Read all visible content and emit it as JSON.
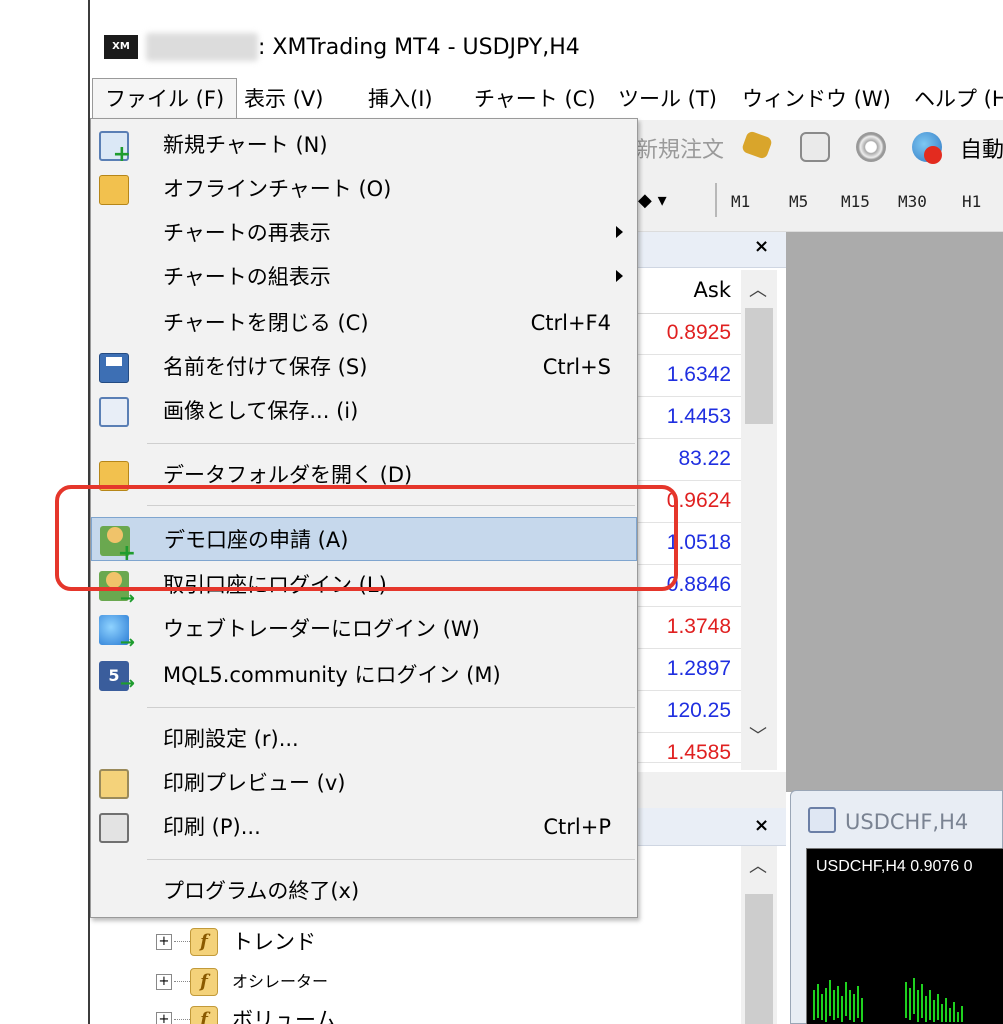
{
  "window": {
    "logo_text": "XM",
    "title": ": XMTrading MT4 - USDJPY,H4"
  },
  "menubar": {
    "items": [
      {
        "label": "ファイル (F)"
      },
      {
        "label": "表示 (V)"
      },
      {
        "label": "挿入(I)"
      },
      {
        "label": "チャート (C)"
      },
      {
        "label": "ツール (T)"
      },
      {
        "label": "ウィンドウ (W)"
      },
      {
        "label": "ヘルプ (H"
      }
    ]
  },
  "toolbar": {
    "new_order_label": "新規注文",
    "auto_trade_label": "自動",
    "timeframes": [
      "M1",
      "M5",
      "M15",
      "M30",
      "H1"
    ]
  },
  "market_watch": {
    "column_ask": "Ask",
    "close_symbol": "×",
    "prices": [
      {
        "value": "0.8925",
        "color": "#e02020"
      },
      {
        "value": "1.6342",
        "color": "#1f2fe0"
      },
      {
        "value": "1.4453",
        "color": "#1f2fe0"
      },
      {
        "value": "83.22",
        "color": "#1f2fe0"
      },
      {
        "value": "0.9624",
        "color": "#e02020"
      },
      {
        "value": "1.0518",
        "color": "#1f2fe0"
      },
      {
        "value": "0.8846",
        "color": "#1f2fe0"
      },
      {
        "value": "1.3748",
        "color": "#e02020"
      },
      {
        "value": "1.2897",
        "color": "#1f2fe0"
      },
      {
        "value": "120.25",
        "color": "#1f2fe0"
      },
      {
        "value": "1.4585",
        "color": "#e02020"
      }
    ]
  },
  "navigator": {
    "close_symbol": "×",
    "tree": [
      {
        "label": "トレンド"
      },
      {
        "label": "オシレーター"
      },
      {
        "label": "ボリューム"
      }
    ]
  },
  "chart_window": {
    "title": "USDCHF,H4",
    "label": "USDCHF,H4  0.9076 0"
  },
  "file_menu": {
    "items": [
      {
        "label": "新規チャート (N)",
        "shortcut": ""
      },
      {
        "label": "オフラインチャート (O)",
        "shortcut": ""
      },
      {
        "label": "チャートの再表示",
        "shortcut": ""
      },
      {
        "label": "チャートの組表示",
        "shortcut": ""
      },
      {
        "label": "チャートを閉じる (C)",
        "shortcut": "Ctrl+F4"
      },
      {
        "label": "名前を付けて保存 (S)",
        "shortcut": "Ctrl+S"
      },
      {
        "label": "画像として保存... (i)",
        "shortcut": ""
      },
      {
        "label": "データフォルダを開く (D)",
        "shortcut": ""
      },
      {
        "label": "デモ口座の申請 (A)",
        "shortcut": ""
      },
      {
        "label": "取引口座にログイン (L)",
        "shortcut": ""
      },
      {
        "label": "ウェブトレーダーにログイン (W)",
        "shortcut": ""
      },
      {
        "label": "MQL5.community にログイン (M)",
        "shortcut": ""
      },
      {
        "label": "印刷設定 (r)...",
        "shortcut": ""
      },
      {
        "label": "印刷プレビュー (v)",
        "shortcut": ""
      },
      {
        "label": "印刷 (P)...",
        "shortcut": "Ctrl+P"
      },
      {
        "label": "プログラムの終了(x)",
        "shortcut": ""
      }
    ]
  },
  "annotation": {
    "color": "#e5362b"
  }
}
